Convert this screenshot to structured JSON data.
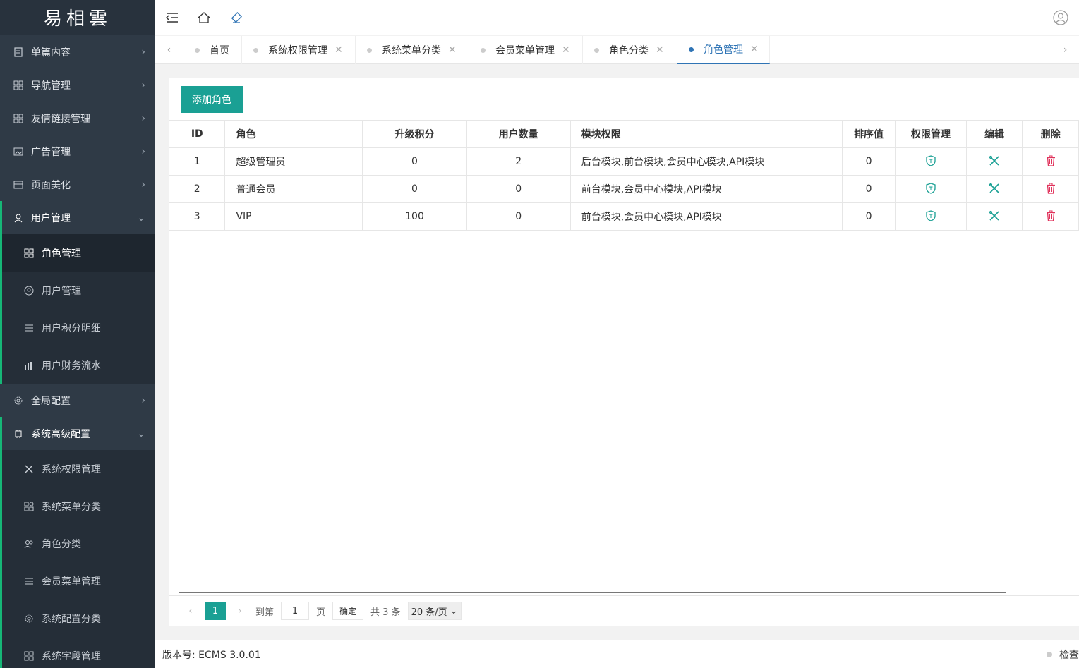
{
  "app": {
    "logo_text": "易相雲"
  },
  "sidebar": {
    "items": [
      {
        "label": "单篇内容",
        "icon": "document-icon"
      },
      {
        "label": "导航管理",
        "icon": "grid-icon"
      },
      {
        "label": "友情链接管理",
        "icon": "grid-icon"
      },
      {
        "label": "广告管理",
        "icon": "image-icon"
      },
      {
        "label": "页面美化",
        "icon": "layout-icon"
      },
      {
        "label": "用户管理",
        "icon": "user-icon"
      }
    ],
    "user_sub": [
      {
        "label": "角色管理",
        "icon": "grid-icon"
      },
      {
        "label": "用户管理",
        "icon": "user-circle-icon"
      },
      {
        "label": "用户积分明细",
        "icon": "list-icon"
      },
      {
        "label": "用户财务流水",
        "icon": "bar-chart-icon"
      }
    ],
    "global": {
      "label": "全局配置",
      "icon": "gear-icon"
    },
    "advanced": {
      "label": "系统高级配置",
      "icon": "chip-icon"
    },
    "advanced_sub": [
      {
        "label": "系统权限管理",
        "icon": "tools-icon"
      },
      {
        "label": "系统菜单分类",
        "icon": "apps-icon"
      },
      {
        "label": "角色分类",
        "icon": "users-icon"
      },
      {
        "label": "会员菜单管理",
        "icon": "list-icon"
      },
      {
        "label": "系统配置分类",
        "icon": "gear-icon"
      },
      {
        "label": "系统字段管理",
        "icon": "grid-icon"
      }
    ]
  },
  "tabs": [
    {
      "label": "首页"
    },
    {
      "label": "系统权限管理"
    },
    {
      "label": "系统菜单分类"
    },
    {
      "label": "会员菜单管理"
    },
    {
      "label": "角色分类"
    },
    {
      "label": "角色管理"
    }
  ],
  "toolbar": {
    "add_label": "添加角色"
  },
  "table": {
    "headers": [
      "ID",
      "角色",
      "升级积分",
      "用户数量",
      "模块权限",
      "排序值",
      "权限管理",
      "编辑",
      "删除"
    ],
    "rows": [
      {
        "id": "1",
        "role": "超级管理员",
        "points": "0",
        "users": "2",
        "modules": "后台模块,前台模块,会员中心模块,API模块",
        "sort": "0"
      },
      {
        "id": "2",
        "role": "普通会员",
        "points": "0",
        "users": "0",
        "modules": "前台模块,会员中心模块,API模块",
        "sort": "0"
      },
      {
        "id": "3",
        "role": "VIP",
        "points": "100",
        "users": "0",
        "modules": "前台模块,会员中心模块,API模块",
        "sort": "0"
      }
    ]
  },
  "pager": {
    "current": "1",
    "goto_label": "到第",
    "goto_value": "1",
    "page_label": "页",
    "confirm_label": "确定",
    "total_label": "共 3 条",
    "per_page": "20 条/页"
  },
  "footer": {
    "version": "版本号: ECMS 3.0.01",
    "right_text": "检查"
  },
  "colors": {
    "accent": "#1aa094",
    "active_tab": "#2f74b5",
    "delete": "#e0325b",
    "sidebar_bg": "#2f3a46"
  }
}
